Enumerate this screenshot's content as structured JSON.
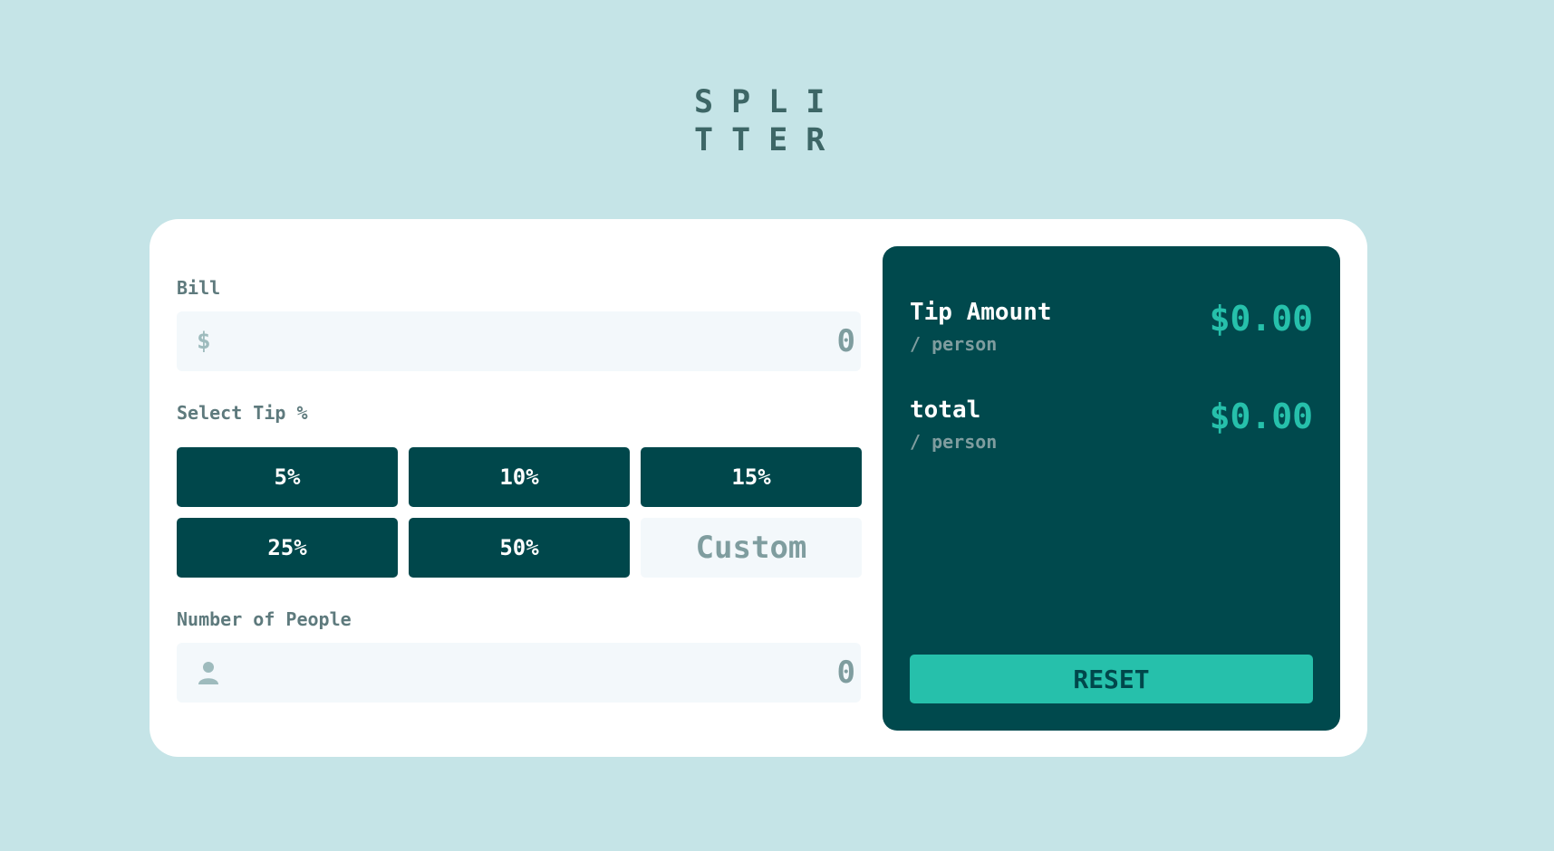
{
  "logo": {
    "line1": "SPLI",
    "line2": "TTER"
  },
  "form": {
    "bill_label": "Bill",
    "bill_icon": "dollar-icon",
    "bill_currency_symbol": "$",
    "bill_placeholder": "0",
    "tip_label": "Select Tip %",
    "tip_options": [
      "5%",
      "10%",
      "15%",
      "25%",
      "50%"
    ],
    "custom_placeholder": "Custom",
    "people_label": "Number of People",
    "people_icon": "person-icon",
    "people_placeholder": "0"
  },
  "results": {
    "tip_title": "Tip Amount",
    "tip_sub": "/ person",
    "tip_value": "$0.00",
    "total_title": "total",
    "total_sub": "/ person",
    "total_value": "$0.00",
    "reset_label": "RESET"
  },
  "colors": {
    "background": "#c5e4e7",
    "panel": "#00494d",
    "accent": "#26c0ab",
    "button": "#00474b"
  }
}
